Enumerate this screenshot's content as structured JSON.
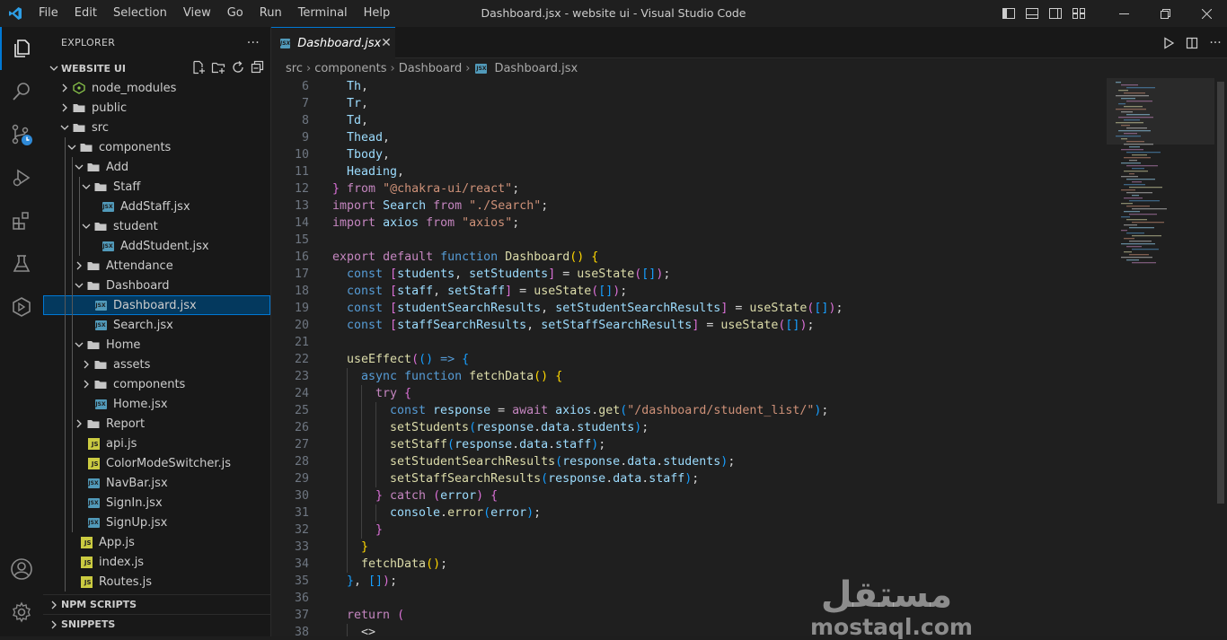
{
  "window": {
    "title": "Dashboard.jsx - website ui - Visual Studio Code"
  },
  "menu": [
    "File",
    "Edit",
    "Selection",
    "View",
    "Go",
    "Run",
    "Terminal",
    "Help"
  ],
  "sidebar": {
    "header": "EXPLORER",
    "more": "···",
    "project": "WEBSITE UI",
    "tree": [
      {
        "label": "node_modules",
        "depth": 1,
        "kind": "folder",
        "open": false,
        "icon": "node-folder"
      },
      {
        "label": "public",
        "depth": 1,
        "kind": "folder",
        "open": false
      },
      {
        "label": "src",
        "depth": 1,
        "kind": "folder",
        "open": true
      },
      {
        "label": "components",
        "depth": 2,
        "kind": "folder",
        "open": true
      },
      {
        "label": "Add",
        "depth": 3,
        "kind": "folder",
        "open": true
      },
      {
        "label": "Staff",
        "depth": 4,
        "kind": "folder",
        "open": true
      },
      {
        "label": "AddStaff.jsx",
        "depth": 5,
        "kind": "jsx"
      },
      {
        "label": "student",
        "depth": 4,
        "kind": "folder",
        "open": true
      },
      {
        "label": "AddStudent.jsx",
        "depth": 5,
        "kind": "jsx"
      },
      {
        "label": "Attendance",
        "depth": 3,
        "kind": "folder",
        "open": false
      },
      {
        "label": "Dashboard",
        "depth": 3,
        "kind": "folder",
        "open": true
      },
      {
        "label": "Dashboard.jsx",
        "depth": 4,
        "kind": "jsx",
        "selected": true
      },
      {
        "label": "Search.jsx",
        "depth": 4,
        "kind": "jsx"
      },
      {
        "label": "Home",
        "depth": 3,
        "kind": "folder",
        "open": true
      },
      {
        "label": "assets",
        "depth": 4,
        "kind": "folder",
        "open": false
      },
      {
        "label": "components",
        "depth": 4,
        "kind": "folder",
        "open": false
      },
      {
        "label": "Home.jsx",
        "depth": 4,
        "kind": "jsx"
      },
      {
        "label": "Report",
        "depth": 3,
        "kind": "folder",
        "open": false
      },
      {
        "label": "api.js",
        "depth": 3,
        "kind": "js"
      },
      {
        "label": "ColorModeSwitcher.js",
        "depth": 3,
        "kind": "js"
      },
      {
        "label": "NavBar.jsx",
        "depth": 3,
        "kind": "jsx"
      },
      {
        "label": "SignIn.jsx",
        "depth": 3,
        "kind": "jsx"
      },
      {
        "label": "SignUp.jsx",
        "depth": 3,
        "kind": "jsx"
      },
      {
        "label": "App.js",
        "depth": 2,
        "kind": "js"
      },
      {
        "label": "index.js",
        "depth": 2,
        "kind": "js"
      },
      {
        "label": "Routes.js",
        "depth": 2,
        "kind": "js"
      }
    ],
    "sections": [
      "NPM SCRIPTS",
      "SNIPPETS"
    ]
  },
  "tab": {
    "label": "Dashboard.jsx",
    "close": "✕"
  },
  "breadcrumb": [
    "src",
    "components",
    "Dashboard",
    "Dashboard.jsx"
  ],
  "code": [
    {
      "n": "6",
      "i": 1,
      "t": [
        [
          "v",
          "Th"
        ],
        [
          "p",
          ","
        ]
      ]
    },
    {
      "n": "7",
      "i": 1,
      "t": [
        [
          "v",
          "Tr"
        ],
        [
          "p",
          ","
        ]
      ]
    },
    {
      "n": "8",
      "i": 1,
      "t": [
        [
          "v",
          "Td"
        ],
        [
          "p",
          ","
        ]
      ]
    },
    {
      "n": "9",
      "i": 1,
      "t": [
        [
          "v",
          "Thead"
        ],
        [
          "p",
          ","
        ]
      ]
    },
    {
      "n": "10",
      "i": 1,
      "t": [
        [
          "v",
          "Tbody"
        ],
        [
          "p",
          ","
        ]
      ]
    },
    {
      "n": "11",
      "i": 1,
      "t": [
        [
          "v",
          "Heading"
        ],
        [
          "p",
          ","
        ]
      ]
    },
    {
      "n": "12",
      "i": 0,
      "t": [
        [
          "b2",
          "}"
        ],
        [
          "p",
          " "
        ],
        [
          "c",
          "from"
        ],
        [
          "p",
          " "
        ],
        [
          "s",
          "\"@chakra-ui/react\""
        ],
        [
          "p",
          ";"
        ]
      ]
    },
    {
      "n": "13",
      "i": 0,
      "t": [
        [
          "c",
          "import"
        ],
        [
          "p",
          " "
        ],
        [
          "v",
          "Search"
        ],
        [
          "p",
          " "
        ],
        [
          "c",
          "from"
        ],
        [
          "p",
          " "
        ],
        [
          "s",
          "\"./Search\""
        ],
        [
          "p",
          ";"
        ]
      ]
    },
    {
      "n": "14",
      "i": 0,
      "t": [
        [
          "c",
          "import"
        ],
        [
          "p",
          " "
        ],
        [
          "v",
          "axios"
        ],
        [
          "p",
          " "
        ],
        [
          "c",
          "from"
        ],
        [
          "p",
          " "
        ],
        [
          "s",
          "\"axios\""
        ],
        [
          "p",
          ";"
        ]
      ]
    },
    {
      "n": "15",
      "i": 0,
      "t": []
    },
    {
      "n": "16",
      "i": 0,
      "t": [
        [
          "c",
          "export"
        ],
        [
          "p",
          " "
        ],
        [
          "c",
          "default"
        ],
        [
          "p",
          " "
        ],
        [
          "k",
          "function"
        ],
        [
          "p",
          " "
        ],
        [
          "f",
          "Dashboard"
        ],
        [
          "b1",
          "()"
        ],
        [
          "p",
          " "
        ],
        [
          "b1",
          "{"
        ]
      ]
    },
    {
      "n": "17",
      "i": 1,
      "t": [
        [
          "k",
          "const"
        ],
        [
          "p",
          " "
        ],
        [
          "b2",
          "["
        ],
        [
          "v",
          "students"
        ],
        [
          "p",
          ", "
        ],
        [
          "v",
          "setStudents"
        ],
        [
          "b2",
          "]"
        ],
        [
          "p",
          " = "
        ],
        [
          "f",
          "useState"
        ],
        [
          "b2",
          "("
        ],
        [
          "b3",
          "[]"
        ],
        [
          "b2",
          ")"
        ],
        [
          "p",
          ";"
        ]
      ]
    },
    {
      "n": "18",
      "i": 1,
      "t": [
        [
          "k",
          "const"
        ],
        [
          "p",
          " "
        ],
        [
          "b2",
          "["
        ],
        [
          "v",
          "staff"
        ],
        [
          "p",
          ", "
        ],
        [
          "v",
          "setStaff"
        ],
        [
          "b2",
          "]"
        ],
        [
          "p",
          " = "
        ],
        [
          "f",
          "useState"
        ],
        [
          "b2",
          "("
        ],
        [
          "b3",
          "[]"
        ],
        [
          "b2",
          ")"
        ],
        [
          "p",
          ";"
        ]
      ]
    },
    {
      "n": "19",
      "i": 1,
      "t": [
        [
          "k",
          "const"
        ],
        [
          "p",
          " "
        ],
        [
          "b2",
          "["
        ],
        [
          "v",
          "studentSearchResults"
        ],
        [
          "p",
          ", "
        ],
        [
          "v",
          "setStudentSearchResults"
        ],
        [
          "b2",
          "]"
        ],
        [
          "p",
          " = "
        ],
        [
          "f",
          "useState"
        ],
        [
          "b2",
          "("
        ],
        [
          "b3",
          "[]"
        ],
        [
          "b2",
          ")"
        ],
        [
          "p",
          ";"
        ]
      ]
    },
    {
      "n": "20",
      "i": 1,
      "t": [
        [
          "k",
          "const"
        ],
        [
          "p",
          " "
        ],
        [
          "b2",
          "["
        ],
        [
          "v",
          "staffSearchResults"
        ],
        [
          "p",
          ", "
        ],
        [
          "v",
          "setStaffSearchResults"
        ],
        [
          "b2",
          "]"
        ],
        [
          "p",
          " = "
        ],
        [
          "f",
          "useState"
        ],
        [
          "b2",
          "("
        ],
        [
          "b3",
          "[]"
        ],
        [
          "b2",
          ")"
        ],
        [
          "p",
          ";"
        ]
      ]
    },
    {
      "n": "21",
      "i": 1,
      "t": []
    },
    {
      "n": "22",
      "i": 1,
      "t": [
        [
          "f",
          "useEffect"
        ],
        [
          "b2",
          "("
        ],
        [
          "b3",
          "()"
        ],
        [
          "p",
          " "
        ],
        [
          "k",
          "=>"
        ],
        [
          "p",
          " "
        ],
        [
          "b3",
          "{"
        ]
      ]
    },
    {
      "n": "23",
      "i": 2,
      "t": [
        [
          "k",
          "async"
        ],
        [
          "p",
          " "
        ],
        [
          "k",
          "function"
        ],
        [
          "p",
          " "
        ],
        [
          "f",
          "fetchData"
        ],
        [
          "b1",
          "()"
        ],
        [
          "p",
          " "
        ],
        [
          "b1",
          "{"
        ]
      ]
    },
    {
      "n": "24",
      "i": 3,
      "t": [
        [
          "c",
          "try"
        ],
        [
          "p",
          " "
        ],
        [
          "b2",
          "{"
        ]
      ]
    },
    {
      "n": "25",
      "i": 4,
      "t": [
        [
          "k",
          "const"
        ],
        [
          "p",
          " "
        ],
        [
          "v",
          "response"
        ],
        [
          "p",
          " = "
        ],
        [
          "c",
          "await"
        ],
        [
          "p",
          " "
        ],
        [
          "v",
          "axios"
        ],
        [
          "p",
          "."
        ],
        [
          "f",
          "get"
        ],
        [
          "b3",
          "("
        ],
        [
          "s",
          "\"/dashboard/student_list/\""
        ],
        [
          "b3",
          ")"
        ],
        [
          "p",
          ";"
        ]
      ]
    },
    {
      "n": "26",
      "i": 4,
      "t": [
        [
          "f",
          "setStudents"
        ],
        [
          "b3",
          "("
        ],
        [
          "v",
          "response"
        ],
        [
          "p",
          "."
        ],
        [
          "v",
          "data"
        ],
        [
          "p",
          "."
        ],
        [
          "v",
          "students"
        ],
        [
          "b3",
          ")"
        ],
        [
          "p",
          ";"
        ]
      ]
    },
    {
      "n": "27",
      "i": 4,
      "t": [
        [
          "f",
          "setStaff"
        ],
        [
          "b3",
          "("
        ],
        [
          "v",
          "response"
        ],
        [
          "p",
          "."
        ],
        [
          "v",
          "data"
        ],
        [
          "p",
          "."
        ],
        [
          "v",
          "staff"
        ],
        [
          "b3",
          ")"
        ],
        [
          "p",
          ";"
        ]
      ]
    },
    {
      "n": "28",
      "i": 4,
      "t": [
        [
          "f",
          "setStudentSearchResults"
        ],
        [
          "b3",
          "("
        ],
        [
          "v",
          "response"
        ],
        [
          "p",
          "."
        ],
        [
          "v",
          "data"
        ],
        [
          "p",
          "."
        ],
        [
          "v",
          "students"
        ],
        [
          "b3",
          ")"
        ],
        [
          "p",
          ";"
        ]
      ]
    },
    {
      "n": "29",
      "i": 4,
      "t": [
        [
          "f",
          "setStaffSearchResults"
        ],
        [
          "b3",
          "("
        ],
        [
          "v",
          "response"
        ],
        [
          "p",
          "."
        ],
        [
          "v",
          "data"
        ],
        [
          "p",
          "."
        ],
        [
          "v",
          "staff"
        ],
        [
          "b3",
          ")"
        ],
        [
          "p",
          ";"
        ]
      ]
    },
    {
      "n": "30",
      "i": 3,
      "t": [
        [
          "b2",
          "}"
        ],
        [
          "p",
          " "
        ],
        [
          "c",
          "catch"
        ],
        [
          "p",
          " "
        ],
        [
          "b2",
          "("
        ],
        [
          "v",
          "error"
        ],
        [
          "b2",
          ")"
        ],
        [
          "p",
          " "
        ],
        [
          "b2",
          "{"
        ]
      ]
    },
    {
      "n": "31",
      "i": 4,
      "t": [
        [
          "v",
          "console"
        ],
        [
          "p",
          "."
        ],
        [
          "f",
          "error"
        ],
        [
          "b3",
          "("
        ],
        [
          "v",
          "error"
        ],
        [
          "b3",
          ")"
        ],
        [
          "p",
          ";"
        ]
      ]
    },
    {
      "n": "32",
      "i": 3,
      "t": [
        [
          "b2",
          "}"
        ]
      ]
    },
    {
      "n": "33",
      "i": 2,
      "t": [
        [
          "b1",
          "}"
        ]
      ]
    },
    {
      "n": "34",
      "i": 2,
      "t": [
        [
          "f",
          "fetchData"
        ],
        [
          "b1",
          "()"
        ],
        [
          "p",
          ";"
        ]
      ]
    },
    {
      "n": "35",
      "i": 1,
      "t": [
        [
          "b3",
          "}"
        ],
        [
          "p",
          ", "
        ],
        [
          "b3",
          "[]"
        ],
        [
          "b2",
          ")"
        ],
        [
          "p",
          ";"
        ]
      ]
    },
    {
      "n": "36",
      "i": 1,
      "t": []
    },
    {
      "n": "37",
      "i": 1,
      "t": [
        [
          "c",
          "return"
        ],
        [
          "p",
          " "
        ],
        [
          "b2",
          "("
        ]
      ]
    },
    {
      "n": "38",
      "i": 2,
      "t": [
        [
          "p",
          "<>"
        ]
      ]
    }
  ],
  "watermark": {
    "arabic": "مستقل",
    "latin": "mostaql.com"
  },
  "colors": {
    "accent": "#0078d4",
    "selection": "#04395e",
    "jsx": "#519aba",
    "js": "#cbcb41",
    "folder": "#c5c5c5"
  }
}
